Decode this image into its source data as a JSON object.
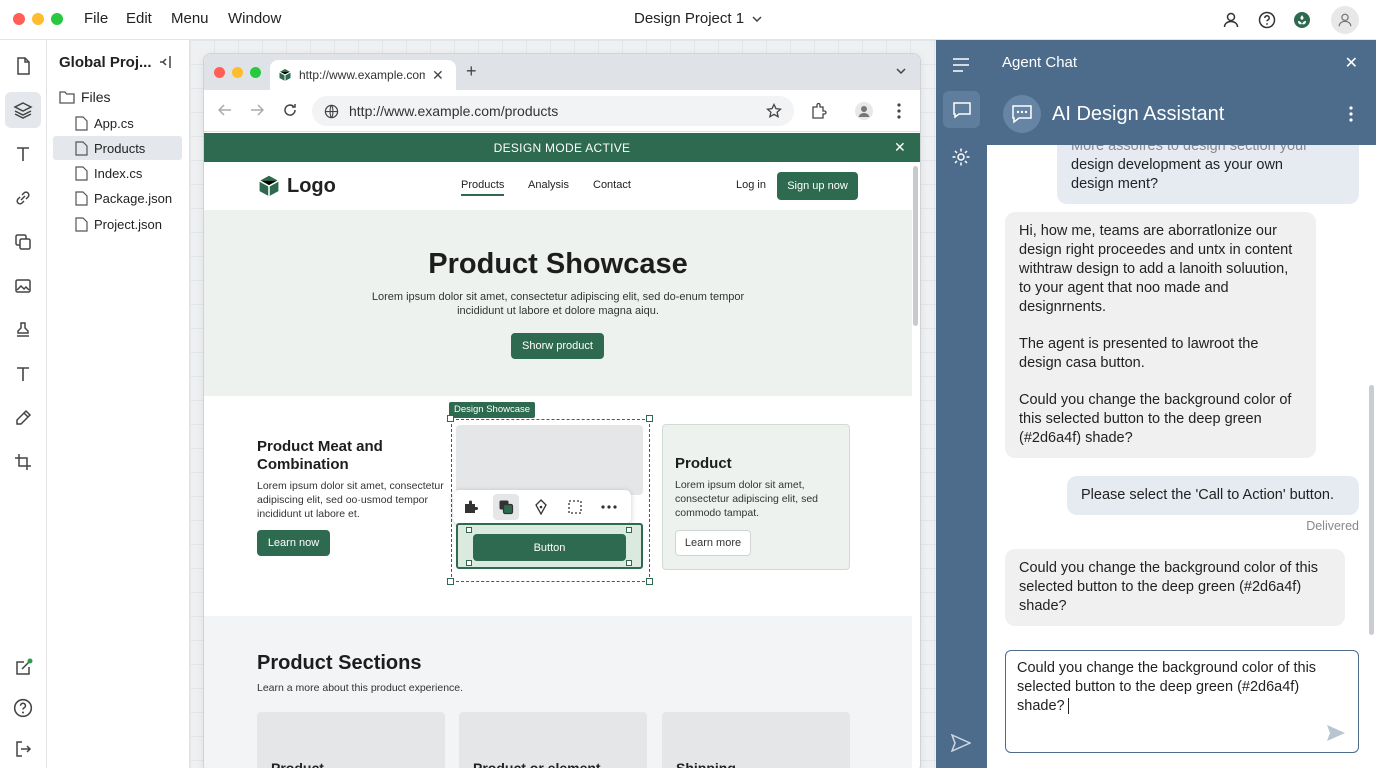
{
  "menubar": {
    "items": [
      "File",
      "Edit",
      "Menu",
      "Window"
    ],
    "title": "Design Project 1"
  },
  "file_panel": {
    "title": "Global Proj...",
    "root": "Files",
    "files": [
      "App.cs",
      "Products",
      "Index.cs",
      "Package.json",
      "Project.json"
    ],
    "selected": "Products"
  },
  "browser": {
    "tab_title": "http://www.example.com",
    "url": "http://www.example.com/products",
    "design_banner": "DESIGN MODE ACTIVE"
  },
  "site": {
    "logo": "Logo",
    "nav": [
      "Products",
      "Analysis",
      "Contact"
    ],
    "login": "Log in",
    "signup": "Sign up now",
    "hero_title": "Product Showcase",
    "hero_text_1": "Lorem ipsum dolor sit amet, consectetur adipiscing elit, sed do-enum tempor",
    "hero_text_2": "incididunt ut labore et dolore magna aiqu.",
    "hero_button": "Shorw product",
    "card1_title_1": "Product Meat and",
    "card1_title_2": "Combination",
    "card1_text_1": "Lorem ipsum dolor sit amet, consectetur",
    "card1_text_2": "adipiscing elit, sed oo·usmod tempor",
    "card1_text_3": "incididunt ut labore et.",
    "card1_button": "Learn now",
    "selection_label": "Design Showcase",
    "selected_button": "Button",
    "card3_title": "Product",
    "card3_text_1": "Lorem ipsum dolor sit amet,",
    "card3_text_2": "consectetur adipiscing elit, sed",
    "card3_text_3": "commodo tampat.",
    "card3_button": "Learn more",
    "sections_title": "Product Sections",
    "sections_sub": "Learn a more about this product experience.",
    "section_cards": [
      "Product",
      "Product or element",
      "Shipping"
    ]
  },
  "chat": {
    "panel_title": "Agent Chat",
    "assistant_name": "AI Design Assistant",
    "messages": [
      {
        "role": "user",
        "lines": [
          "More assofres to design section your",
          "design development as your own",
          "design ment?"
        ]
      },
      {
        "role": "agent",
        "lines": [
          "Hi, how me, teams are aborratlonize our",
          "design right proceedes and untx in content",
          "withtraw design to add a lanoith soluution,",
          "to your agent that noo made and",
          "designrnents.",
          "",
          "The agent is presented to lawroot the",
          "design casa button.",
          "",
          "Could you change the background color of",
          "this selected button to the deep green",
          "(#2d6a4f) shade?"
        ]
      },
      {
        "role": "user",
        "lines": [
          "Please select the 'Call to Action' button."
        ]
      },
      {
        "role": "agent",
        "lines": [
          "Could you change the background color of this",
          "selected button to the deep green (#2d6a4f)",
          "shade?"
        ]
      }
    ],
    "delivered": "Delivered",
    "input_value": "Could you change the background color of this selected button to the deep green (#2d6a4f) shade?"
  },
  "colors": {
    "accent": "#2d6a4f",
    "chat_header": "#4d6b8a"
  }
}
